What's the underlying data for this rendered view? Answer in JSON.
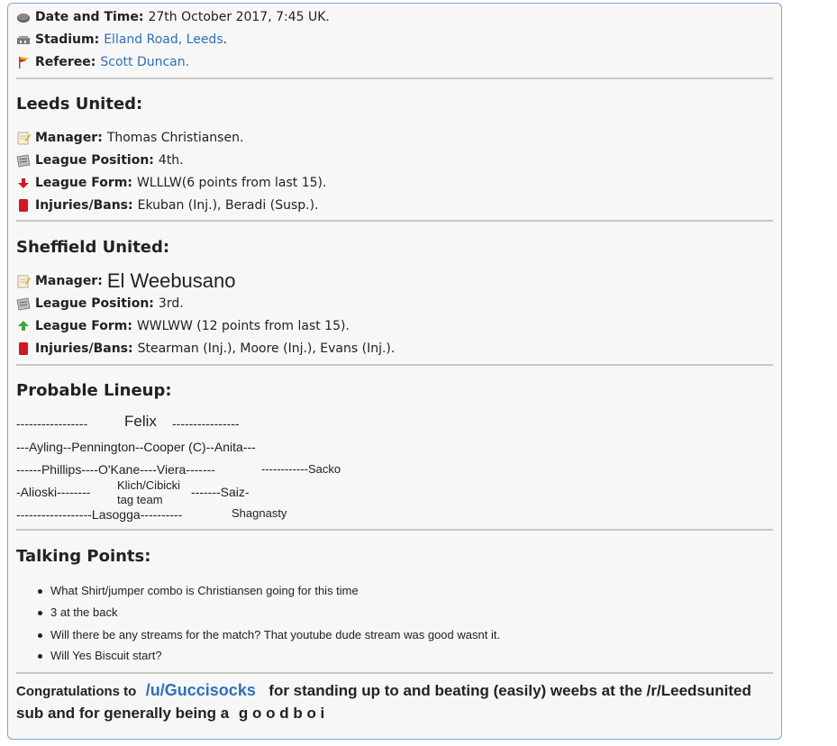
{
  "match": {
    "datetime_label": "Date and Time:",
    "datetime_value": "27th October 2017, 7:45 UK.",
    "stadium_label": "Stadium:",
    "stadium_value": "Elland Road, Leeds",
    "stadium_dot": ".",
    "referee_label": "Referee:",
    "referee_value": "Scott Duncan."
  },
  "leeds": {
    "heading": "Leeds United:",
    "manager_label": "Manager:",
    "manager_value": "Thomas Christiansen.",
    "position_label": "League Position:",
    "position_value": "4th.",
    "form_label": "League Form:",
    "form_value": "WLLLW(6 points from last 15).",
    "injuries_label": "Injuries/Bans:",
    "injuries_value": "Ekuban (Inj.), Beradi (Susp.)."
  },
  "sheffield": {
    "heading": "Sheffield United:",
    "manager_label": "Manager:",
    "manager_value": "El Weebusano",
    "position_label": "League Position:",
    "position_value": "3rd.",
    "form_label": "League Form:",
    "form_value": "WWLWW (12 points from last 15).",
    "injuries_label": "Injuries/Bans:",
    "injuries_value": "Stearman (Inj.), Moore (Inj.), Evans (Inj.)."
  },
  "lineup": {
    "heading": "Probable Lineup:",
    "gk_left": "-----------------",
    "gk_name": "Felix",
    "gk_right": "----------------",
    "def_line": "---Ayling--Pennington--Cooper (C)--Anita---",
    "mid_line": "------Phillips----O'Kane----Viera-------",
    "mid_extra": "------------Sacko",
    "am_left": "-Alioski--------",
    "am_center_1": "Klich/Cibicki",
    "am_center_2": "tag team",
    "am_right": "-------Saiz-",
    "st_line": "------------------Lasogga----------",
    "st_extra": "Shagnasty"
  },
  "talking_points": {
    "heading": "Talking Points:",
    "items": [
      "What Shirt/jumper combo is Christiansen going for this time",
      "3 at the back",
      "Will there be any streams for the match? That youtube dude stream was good wasnt it.",
      "Will Yes Biscuit start?"
    ]
  },
  "congrats": {
    "prefix": "Congratulations to",
    "user": "/u/Guccisocks",
    "suffix": "for standing up to and beating (easily) weebs at the /r/Leedsunited",
    "line2": "sub and for generally being a",
    "spaced": "g o o d b o i"
  },
  "icons": {
    "datetime": "clock-icon",
    "stadium": "stadium-icon",
    "referee": "flag-icon",
    "manager": "memo-icon",
    "position": "newspaper-icon",
    "form_down": "red-down-arrow-icon",
    "form_up": "green-up-arrow-icon",
    "injuries": "red-card-icon"
  },
  "colors": {
    "link": "#2f6fb8",
    "border": "#7fa6c9",
    "divider": "#c8c8bf",
    "red_card": "#d0191f",
    "green_arrow": "#3aa83a",
    "red_arrow": "#d0191f"
  }
}
